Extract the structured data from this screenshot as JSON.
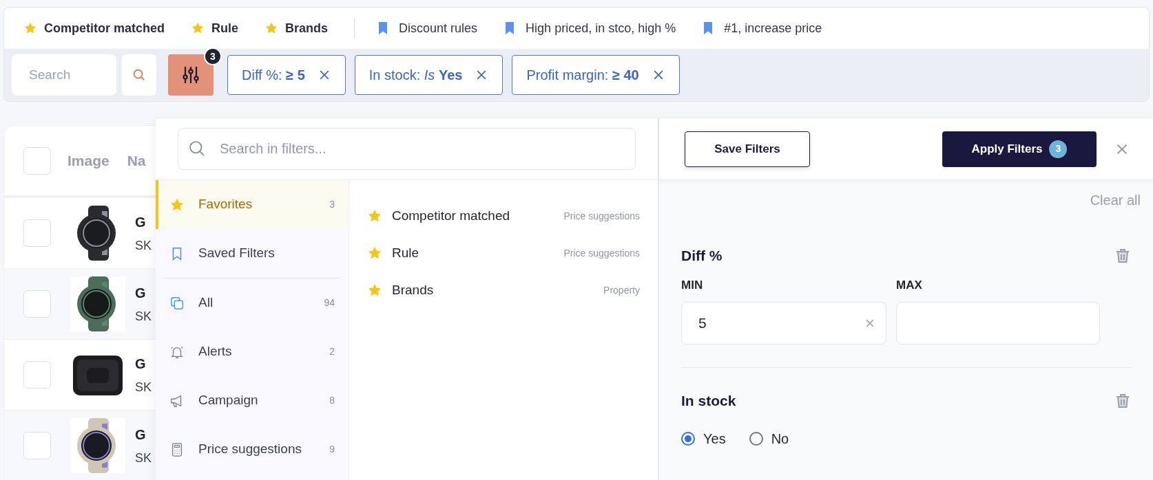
{
  "favorites_bar": [
    {
      "kind": "favorite",
      "label": "Competitor matched"
    },
    {
      "kind": "favorite",
      "label": "Rule"
    },
    {
      "kind": "favorite",
      "label": "Brands"
    },
    {
      "kind": "saved",
      "label": "Discount rules"
    },
    {
      "kind": "saved",
      "label": "High priced, in stco, high %"
    },
    {
      "kind": "saved",
      "label": "#1, increase price"
    }
  ],
  "search": {
    "placeholder": "Search"
  },
  "filter_button": {
    "badge": "3"
  },
  "chips": [
    {
      "text": "Diff %: **≥ 5**"
    },
    {
      "text": "In stock: *Is* **Yes**"
    },
    {
      "text": "Profit margin: **≥ 40**"
    }
  ],
  "table": {
    "header_checked": false,
    "columns": [
      "Image",
      "Na"
    ],
    "rows": [
      {
        "checked": false,
        "name": "G",
        "sku": "SK"
      },
      {
        "checked": false,
        "name": "G",
        "sku": "SK"
      },
      {
        "checked": false,
        "name": "G",
        "sku": "SK"
      },
      {
        "checked": false,
        "name": "G",
        "sku": "SK"
      }
    ]
  },
  "filter_menu": {
    "search": {
      "placeholder": "Search in filters..."
    },
    "category_groups": [
      [
        {
          "label": "Favorites",
          "count": "3",
          "selected": true
        },
        {
          "label": "Saved Filters",
          "selected": false
        }
      ],
      [
        {
          "label": "All",
          "count": "94",
          "selected": false
        },
        {
          "label": "Alerts",
          "count": "2",
          "selected": false
        },
        {
          "label": "Campaign",
          "count": "8",
          "selected": false
        },
        {
          "label": "Price suggestions",
          "count": "9",
          "selected": false
        }
      ]
    ],
    "favorites": [
      {
        "label": "Competitor matched",
        "category": "Price suggestions"
      },
      {
        "label": "Rule",
        "category": "Price suggestions"
      },
      {
        "label": "Brands",
        "category": "Property"
      }
    ]
  },
  "editor": {
    "save_button": "Save Filters",
    "apply_button": {
      "label": "Apply Filters",
      "badge": "3"
    },
    "clear_all": "Clear all",
    "filters": [
      {
        "kind": "range",
        "title": "Diff %",
        "min": {
          "label": "MIN",
          "value": "5"
        },
        "max": {
          "label": "MAX"
        }
      },
      {
        "kind": "radio",
        "title": "In stock",
        "options": [
          {
            "label": "Yes",
            "selected": true
          },
          {
            "label": "No",
            "selected": false
          }
        ]
      }
    ]
  }
}
